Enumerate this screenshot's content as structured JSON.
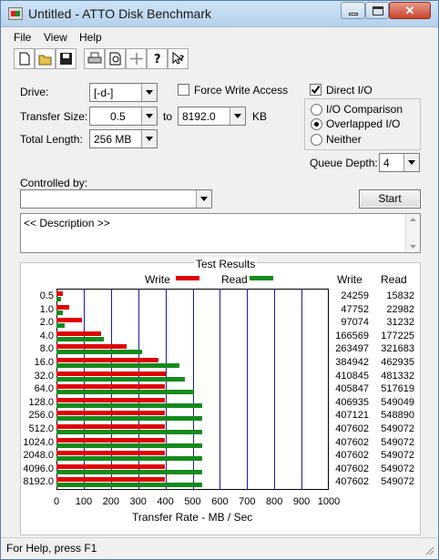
{
  "window": {
    "title": "Untitled - ATTO Disk Benchmark"
  },
  "menu": {
    "items": [
      "File",
      "View",
      "Help"
    ]
  },
  "toolbar": {
    "icons": [
      "new-icon",
      "open-icon",
      "save-icon",
      "print-icon",
      "print-preview-icon",
      "move-icon",
      "help-icon",
      "context-help-icon"
    ]
  },
  "form": {
    "drive_label": "Drive:",
    "drive_value": "[-d-]",
    "force_write_label": "Force Write Access",
    "force_write_checked": false,
    "direct_io_label": "Direct I/O",
    "direct_io_checked": true,
    "transfer_size_label": "Transfer Size:",
    "transfer_size_from": "0.5",
    "to_label": "to",
    "transfer_size_to": "8192.0",
    "kb_label": "KB",
    "total_length_label": "Total Length:",
    "total_length_value": "256 MB",
    "radio_options": [
      "I/O Comparison",
      "Overlapped I/O",
      "Neither"
    ],
    "radio_selected": 1,
    "queue_depth_label": "Queue Depth:",
    "queue_depth_value": "4",
    "controlled_by_label": "Controlled by:",
    "controlled_by_value": "",
    "start_button": "Start",
    "description": "<< Description >>"
  },
  "results": {
    "title": "Test Results",
    "write_legend": "Write",
    "read_legend": "Read",
    "write_col_header": "Write",
    "read_col_header": "Read",
    "x_axis_label": "Transfer Rate - MB / Sec"
  },
  "chart_data": {
    "type": "bar",
    "orientation": "horizontal",
    "title": "Test Results",
    "xlabel": "Transfer Rate - MB / Sec",
    "xlim": [
      0,
      1000
    ],
    "xticks": [
      0,
      100,
      200,
      300,
      400,
      500,
      600,
      700,
      800,
      900,
      1000
    ],
    "categories": [
      "0.5",
      "1.0",
      "2.0",
      "4.0",
      "8.0",
      "16.0",
      "32.0",
      "64.0",
      "128.0",
      "256.0",
      "512.0",
      "1024.0",
      "2048.0",
      "4096.0",
      "8192.0"
    ],
    "series": [
      {
        "name": "Write",
        "color": "#e00000",
        "values": [
          24259,
          47752,
          97074,
          166569,
          263497,
          384942,
          410845,
          405847,
          406935,
          407121,
          407602,
          407602,
          407602,
          407602,
          407602
        ]
      },
      {
        "name": "Read",
        "color": "#158a1c",
        "values": [
          15832,
          22982,
          31232,
          177225,
          321683,
          462935,
          481332,
          517619,
          549049,
          548890,
          549072,
          549072,
          549072,
          549072,
          549072
        ]
      }
    ],
    "grid": true,
    "legend": "top"
  },
  "status": {
    "text": "For Help, press F1"
  }
}
